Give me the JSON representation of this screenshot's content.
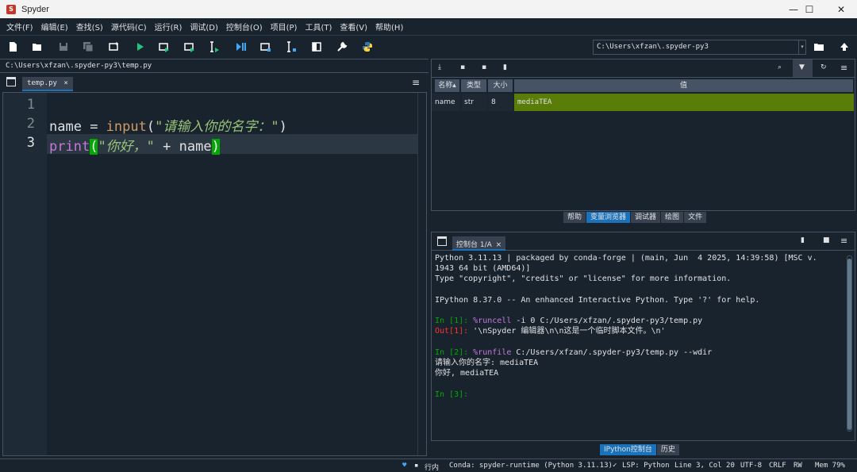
{
  "window": {
    "title": "Spyder",
    "minimize": "—",
    "maximize": "☐",
    "close": "✕"
  },
  "menu": [
    "文件(F)",
    "编辑(E)",
    "查找(S)",
    "源代码(C)",
    "运行(R)",
    "调试(D)",
    "控制台(O)",
    "项目(P)",
    "工具(T)",
    "查看(V)",
    "帮助(H)"
  ],
  "toolbar": {
    "working_dir": "C:\\Users\\xfzan\\.spyder-py3",
    "icons": [
      "new-file-icon",
      "open-file-icon",
      "save-icon",
      "save-all-icon",
      "new-cell-icon",
      "run-icon",
      "run-cell-icon",
      "run-cell-advance-icon",
      "run-selection-icon",
      "debug-icon",
      "debug-cell-icon",
      "debug-selection-icon",
      "maximize-pane-icon",
      "preferences-icon",
      "python-path-icon"
    ],
    "browse_icon": "folder-icon",
    "parent_icon": "up-arrow-icon"
  },
  "editor": {
    "path": "C:\\Users\\xfzan\\.spyder-py3\\temp.py",
    "tab_label": "temp.py",
    "tab_close": "×",
    "line_numbers": [
      "1",
      "2",
      "3"
    ],
    "current_line": 3,
    "lines": {
      "l2_var": "name",
      "l2_op": " = ",
      "l2_fn": "input",
      "l2_open": "(",
      "l2_str": "\"请输入你的名字：\"",
      "l2_close": ")",
      "l3_fn": "print",
      "l3_open": "(",
      "l3_str": "\"你好，\"",
      "l3_plus": " + ",
      "l3_var": "name",
      "l3_close": ")"
    }
  },
  "variable_explorer": {
    "columns": [
      "名称▴",
      "类型",
      "大小",
      "值"
    ],
    "rows": [
      {
        "name": "name",
        "type": "str",
        "size": "8",
        "value": "mediaTEA"
      }
    ],
    "value_color": "#5a7d0a",
    "tabs": [
      "帮助",
      "变量浏览器",
      "调试器",
      "绘图",
      "文件"
    ],
    "active_tab": "变量浏览器"
  },
  "console": {
    "tab_label": "控制台 1/A",
    "tab_close": "×",
    "lines": {
      "banner1": "Python 3.11.13 | packaged by conda-forge | (main, Jun  4 2025, 14:39:58) [MSC v.",
      "banner2": "1943 64 bit (AMD64)]",
      "banner3": "Type \"copyright\", \"credits\" or \"license\" for more information.",
      "banner4": "IPython 8.37.0 -- An enhanced Interactive Python. Type '?' for help.",
      "in1_prompt": "In [1]: ",
      "in1_cmd": "%runcell",
      "in1_rest": " -i 0 C:/Users/xfzan/.spyder-py3/temp.py",
      "out1_prompt": "Out[1]: ",
      "out1_value": "'\\nSpyder 编辑器\\n\\n这是一个临时脚本文件。\\n'",
      "in2_prompt": "In [2]: ",
      "in2_cmd": "%runfile",
      "in2_rest": " C:/Users/xfzan/.spyder-py3/temp.py --wdir",
      "io1": "请输入你的名字: mediaTEA",
      "io2": "你好, mediaTEA",
      "in3_prompt": "In [3]:"
    },
    "tabs": [
      "IPython控制台",
      "历史"
    ],
    "active_tab": "IPython控制台"
  },
  "statusbar": {
    "heart": "♥",
    "wrap": "行内",
    "conda": "Conda: spyder-runtime (Python 3.11.13)",
    "lsp_check": "✓",
    "lsp": "LSP: Python",
    "position": "Line 3, Col 20",
    "encoding": "UTF-8",
    "eol": "CRLF",
    "mode": "RW",
    "mem": "Mem 79%"
  }
}
